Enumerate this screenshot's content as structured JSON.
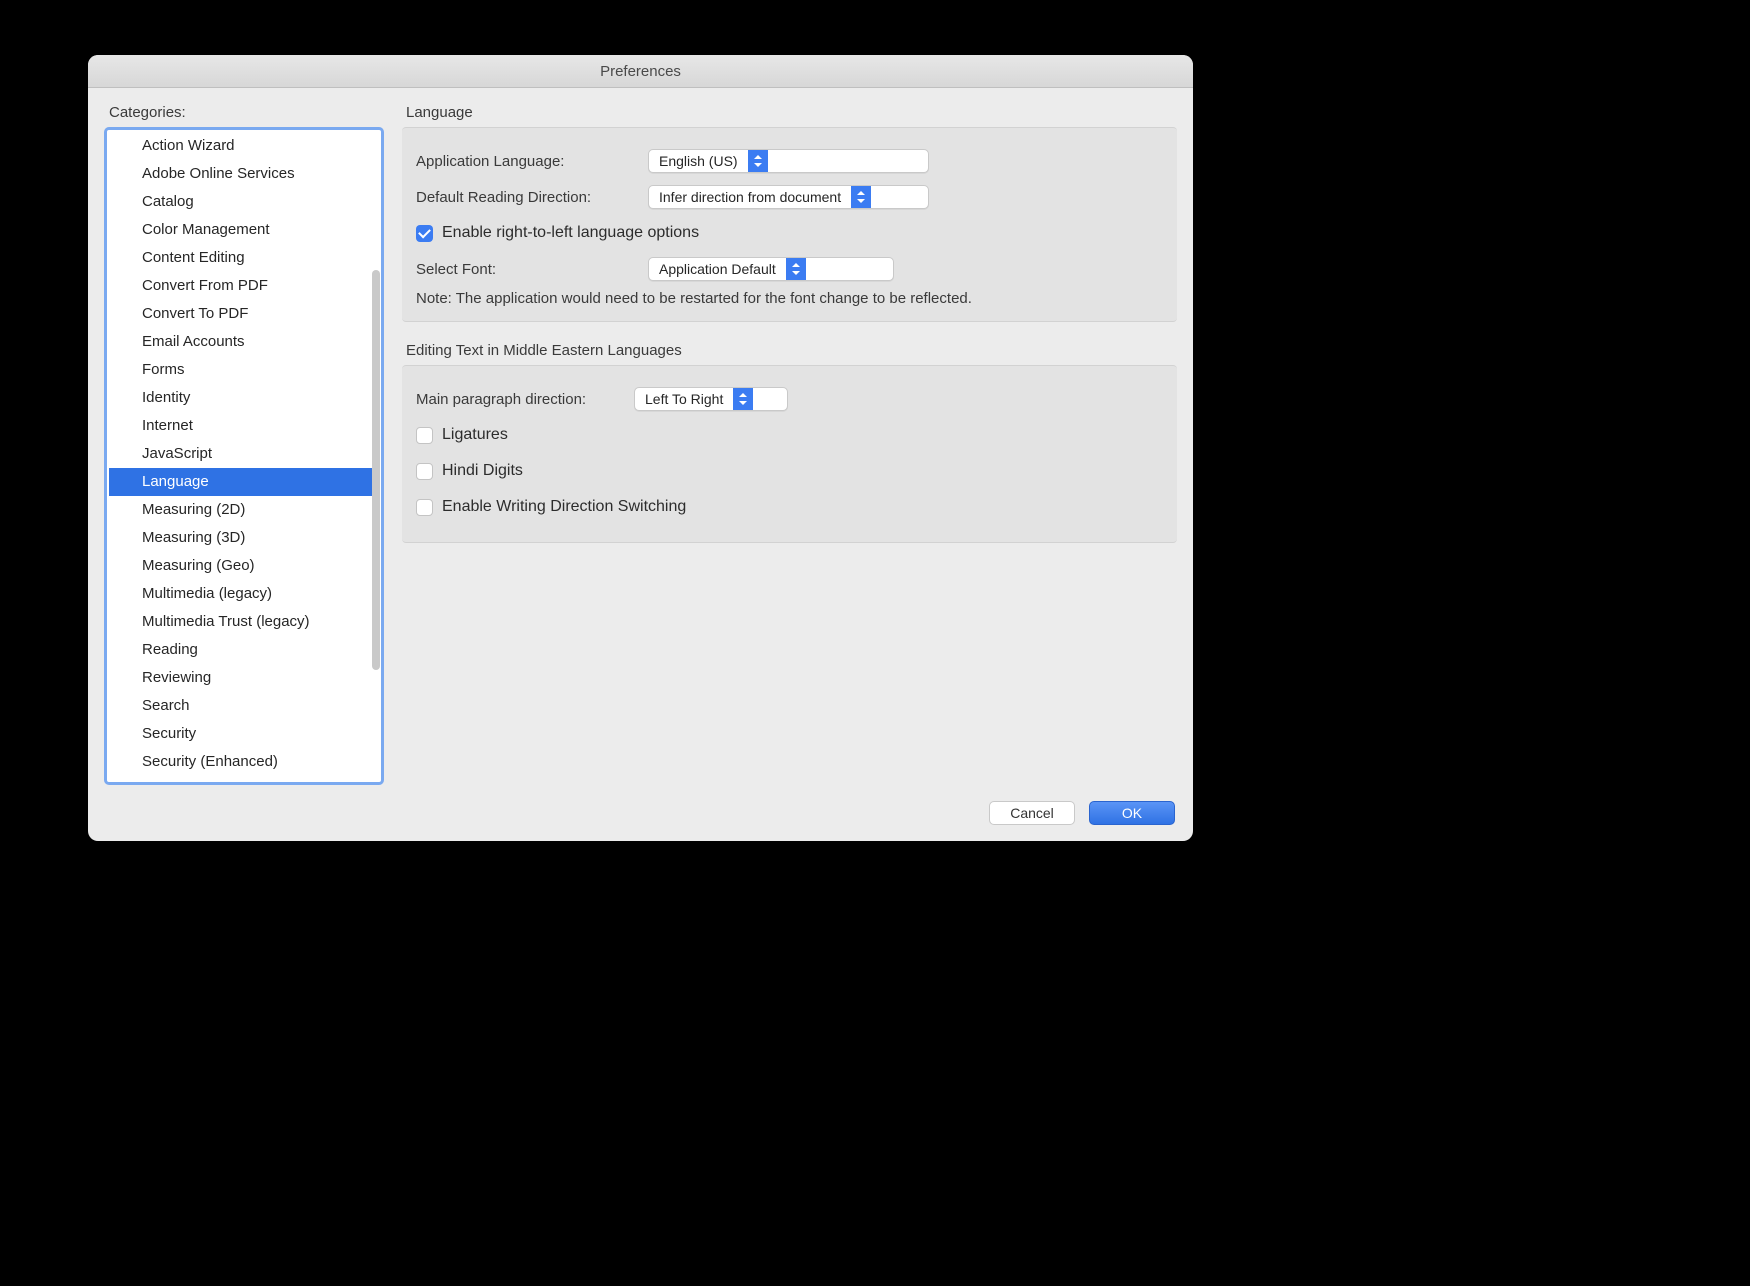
{
  "window": {
    "title": "Preferences"
  },
  "sidebar": {
    "label": "Categories:",
    "items": [
      "Action Wizard",
      "Adobe Online Services",
      "Catalog",
      "Color Management",
      "Content Editing",
      "Convert From PDF",
      "Convert To PDF",
      "Email Accounts",
      "Forms",
      "Identity",
      "Internet",
      "JavaScript",
      "Language",
      "Measuring (2D)",
      "Measuring (3D)",
      "Measuring (Geo)",
      "Multimedia (legacy)",
      "Multimedia Trust (legacy)",
      "Reading",
      "Reviewing",
      "Search",
      "Security",
      "Security (Enhanced)"
    ],
    "selected_index": 12
  },
  "panel1": {
    "title": "Language",
    "app_language_label": "Application Language:",
    "app_language_value": "English (US)",
    "reading_dir_label": "Default Reading Direction:",
    "reading_dir_value": "Infer direction from document",
    "rtl_checkbox_label": "Enable right-to-left language options",
    "rtl_checked": true,
    "select_font_label": "Select Font:",
    "select_font_value": "Application Default",
    "note": "Note: The application would need to be restarted for the font change to be reflected."
  },
  "panel2": {
    "title": "Editing Text in Middle Eastern Languages",
    "main_para_label": "Main paragraph direction:",
    "main_para_value": "Left To Right",
    "ligatures_label": "Ligatures",
    "ligatures_checked": false,
    "hindi_digits_label": "Hindi Digits",
    "hindi_digits_checked": false,
    "wdir_label": "Enable Writing Direction Switching",
    "wdir_checked": false
  },
  "buttons": {
    "cancel": "Cancel",
    "ok": "OK"
  }
}
